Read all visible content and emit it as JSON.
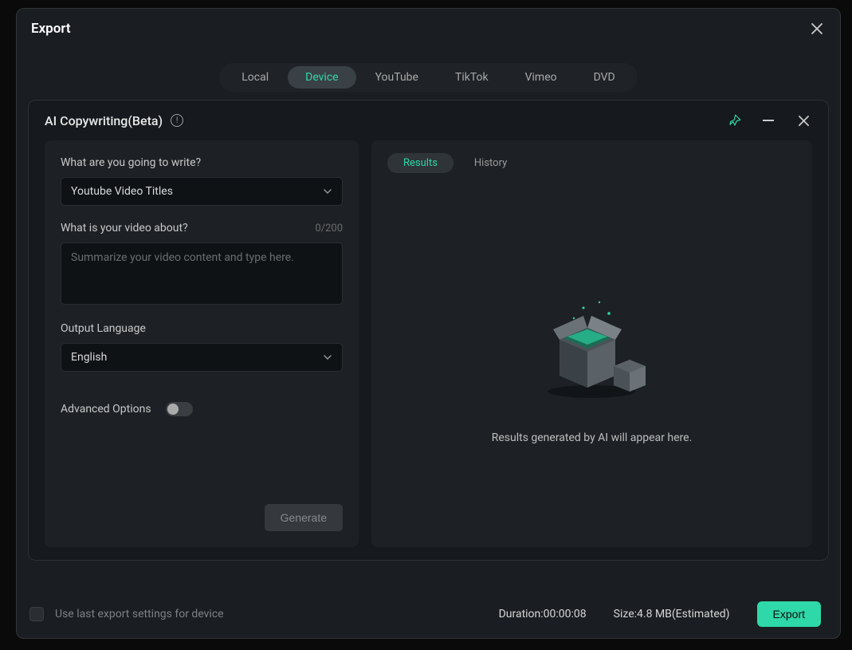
{
  "outer": {
    "title": "Export",
    "tabs": [
      "Local",
      "Device",
      "YouTube",
      "TikTok",
      "Vimeo",
      "DVD"
    ],
    "active_tab": "Device"
  },
  "inner": {
    "title": "AI Copywriting(Beta)"
  },
  "form": {
    "write_label": "What are you going to write?",
    "write_value": "Youtube Video Titles",
    "about_label": "What is your video about?",
    "about_counter": "0/200",
    "about_placeholder": "Summarize your video content and type here.",
    "lang_label": "Output Language",
    "lang_value": "English",
    "advanced_label": "Advanced Options",
    "generate_label": "Generate"
  },
  "results": {
    "tab_results": "Results",
    "tab_history": "History",
    "empty_text": "Results generated by AI will appear here."
  },
  "footer": {
    "checkbox_label": "Use last export settings for device",
    "duration_label": "Duration:",
    "duration_value": "00:00:08",
    "size_label": "Size:",
    "size_value": "4.8 MB(Estimated)",
    "export_label": "Export"
  }
}
